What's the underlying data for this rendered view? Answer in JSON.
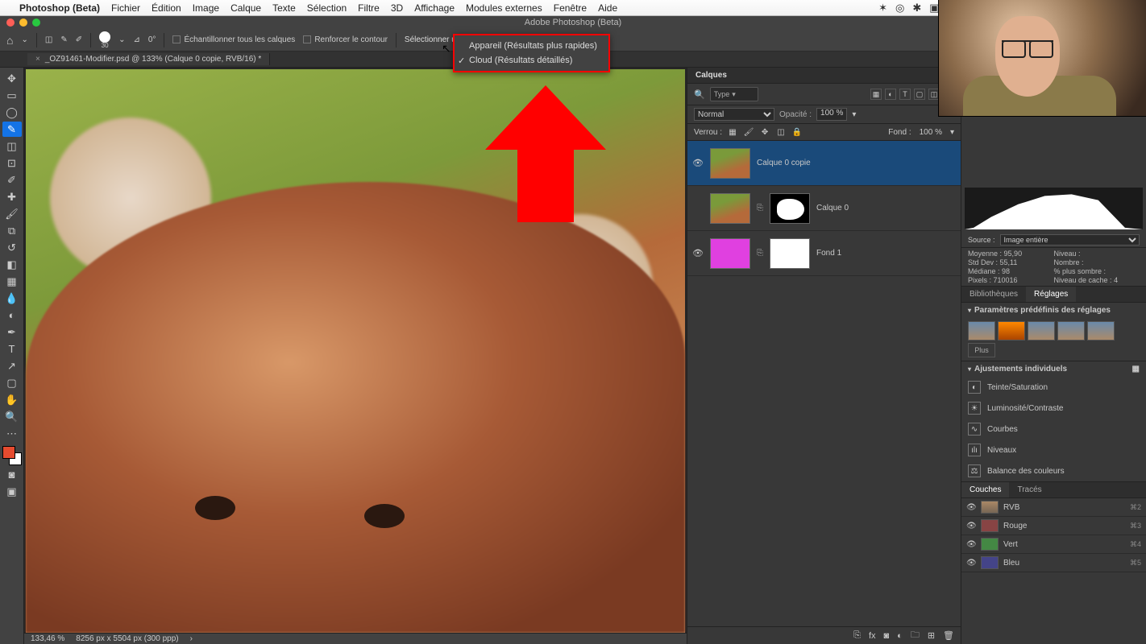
{
  "menubar": {
    "app": "Photoshop (Beta)",
    "items": [
      "Fichier",
      "Édition",
      "Image",
      "Calque",
      "Texte",
      "Sélection",
      "Filtre",
      "3D",
      "Affichage",
      "Modules externes",
      "Fenêtre",
      "Aide"
    ]
  },
  "window_title": "Adobe Photoshop (Beta)",
  "options_bar": {
    "brush_size": "30",
    "angle": "0°",
    "sample_all": "Échantillonner tous les calques",
    "refine": "Renforcer le contour",
    "select_subject": "Sélectionner un sujet"
  },
  "dropdown": {
    "option1": "Appareil (Résultats plus rapides)",
    "option2": "Cloud (Résultats détaillés)"
  },
  "document_tab": "_OZ91461-Modifier.psd @ 133% (Calque 0 copie, RVB/16) *",
  "status": {
    "zoom": "133,46 %",
    "dims": "8256 px x 5504 px (300 ppp)"
  },
  "layers_panel": {
    "title": "Calques",
    "kind": "Type",
    "blend_mode": "Normal",
    "opacity_label": "Opacité :",
    "opacity_value": "100 %",
    "lock_label": "Verrou :",
    "fill_label": "Fond :",
    "fill_value": "100 %",
    "layers": [
      {
        "name": "Calque 0 copie"
      },
      {
        "name": "Calque 0"
      },
      {
        "name": "Fond 1"
      }
    ]
  },
  "histogram": {
    "source_label": "Source :",
    "source_value": "Image entière",
    "stats": {
      "mean_l": "Moyenne :",
      "mean_v": "95,90",
      "std_l": "Std Dev :",
      "std_v": "55,11",
      "med_l": "Médiane :",
      "med_v": "98",
      "pix_l": "Pixels :",
      "pix_v": "710016",
      "lvl_l": "Niveau :",
      "cnt_l": "Nombre :",
      "dark_l": "% plus sombre :",
      "cache_l": "Niveau de cache :",
      "cache_v": "4"
    }
  },
  "right_tabs": {
    "lib": "Bibliothèques",
    "adj": "Réglages"
  },
  "presets_title": "Paramètres prédéfinis des réglages",
  "presets_more": "Plus",
  "adjustments_title": "Ajustements individuels",
  "adjustments": {
    "hue": "Teinte/Saturation",
    "bc": "Luminosité/Contraste",
    "curves": "Courbes",
    "levels": "Niveaux",
    "color": "Balance des couleurs"
  },
  "channels_tabs": {
    "couches": "Couches",
    "traces": "Tracés"
  },
  "channels": {
    "rvb": {
      "name": "RVB",
      "sc": "⌘2"
    },
    "r": {
      "name": "Rouge",
      "sc": "⌘3"
    },
    "g": {
      "name": "Vert",
      "sc": "⌘4"
    },
    "b": {
      "name": "Bleu",
      "sc": "⌘5"
    }
  }
}
